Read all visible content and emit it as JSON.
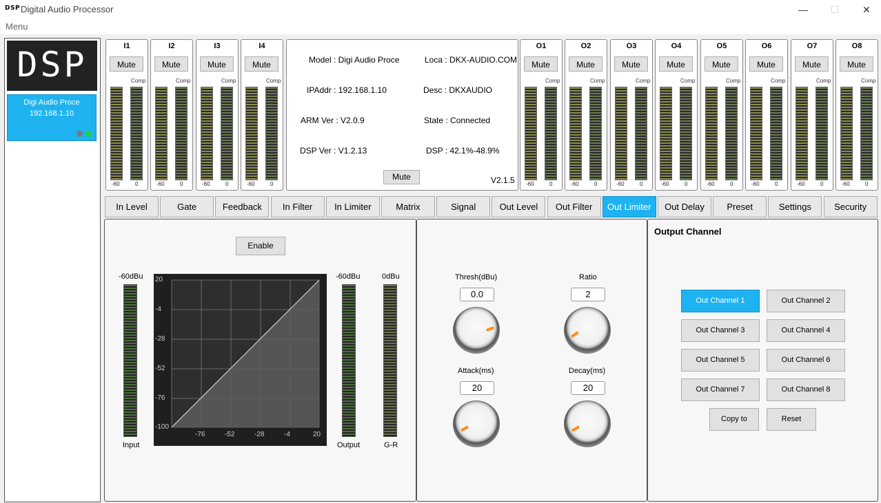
{
  "window": {
    "logo": "DSP",
    "title": "Digital Audio Processor",
    "menu": "Menu",
    "minimize": "—",
    "maximize": "☐",
    "close": "✕"
  },
  "device": {
    "logo": "DSP",
    "name": "Digi Audio Proce",
    "ip": "192.168.1.10",
    "indicator_colors": [
      "#7a7a7a",
      "#22cc44"
    ]
  },
  "channels": {
    "mute_label": "Mute",
    "comp_label": "Comp",
    "scale_min": "-60",
    "scale_max": "0",
    "inputs": [
      "I1",
      "I2",
      "I3",
      "I4"
    ],
    "outputs": [
      "O1",
      "O2",
      "O3",
      "O4",
      "O5",
      "O6",
      "O7",
      "O8"
    ]
  },
  "info": {
    "model": "Model : Digi Audio Proce",
    "location": "Loca : DKX-AUDIO.COM",
    "ipaddr": "IPAddr : 192.168.1.10",
    "desc": "Desc : DKXAUDIO",
    "arm_ver": "ARM Ver : V2.0.9",
    "state": "State : Connected",
    "dsp_ver": "DSP Ver : V1.2.13",
    "dsp_load": "DSP : 42.1%-48.9%",
    "mute": "Mute",
    "version": "V2.1.5"
  },
  "tabs": [
    "In Level",
    "Gate",
    "Feedback",
    "In Filter",
    "In Limiter",
    "Matrix",
    "Signal",
    "Out Level",
    "Out Filter",
    "Out Limiter",
    "Out Delay",
    "Preset",
    "Settings",
    "Security"
  ],
  "active_tab": "Out Limiter",
  "limiter": {
    "enable": "Enable",
    "input_top": "-60dBu",
    "output_top": "-60dBu",
    "gr_top": "0dBu",
    "input_label": "Input",
    "output_label": "Output",
    "gr_label": "G-R",
    "graph_y_ticks": [
      "20",
      "-4",
      "-28",
      "-52",
      "-76",
      "-100"
    ],
    "graph_x_ticks": [
      "-76",
      "-52",
      "-28",
      "-4",
      "20"
    ]
  },
  "params": {
    "thresh_label": "Thresh(dBu)",
    "thresh_value": "0.0",
    "ratio_label": "Ratio",
    "ratio_value": "2",
    "attack_label": "Attack(ms)",
    "attack_value": "20",
    "decay_label": "Decay(ms)",
    "decay_value": "20"
  },
  "output_channel": {
    "title": "Output Channel",
    "buttons": [
      "Out Channel 1",
      "Out Channel 2",
      "Out Channel 3",
      "Out Channel 4",
      "Out Channel 5",
      "Out Channel 6",
      "Out Channel 7",
      "Out Channel 8"
    ],
    "selected": "Out Channel 1",
    "copy": "Copy to",
    "reset": "Reset"
  },
  "colors": {
    "accent": "#1eb3f0"
  }
}
